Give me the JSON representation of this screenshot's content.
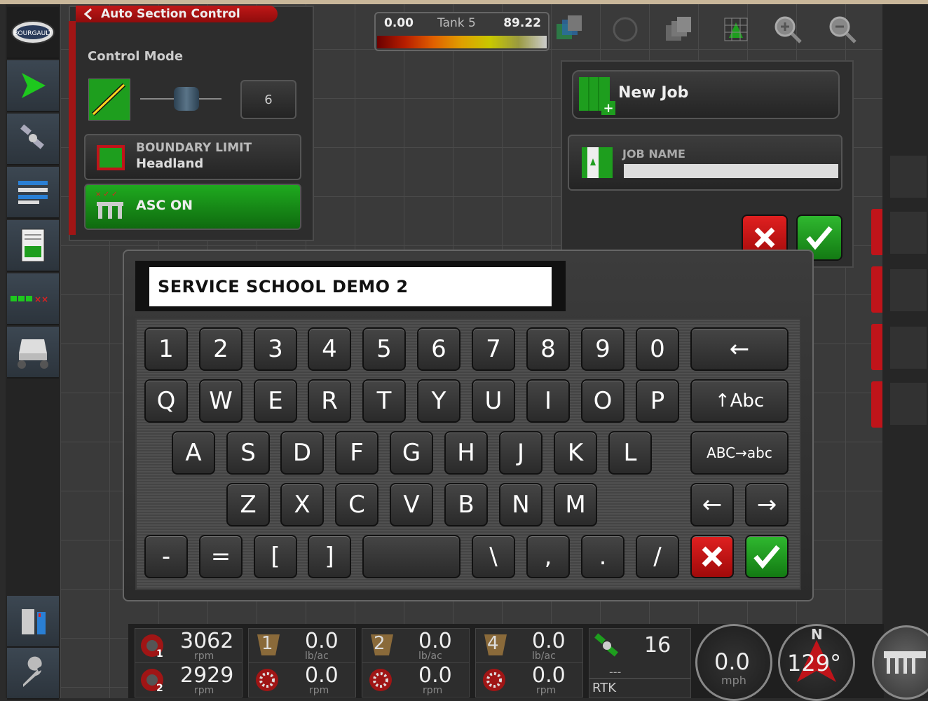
{
  "asc": {
    "title": "Auto Section Control",
    "control_mode_label": "Control Mode",
    "section_value": "6",
    "boundary_label": "BOUNDARY LIMIT",
    "boundary_value": "Headland",
    "asc_label": "ASC ON"
  },
  "tank": {
    "left_value": "0.00",
    "name": "Tank 5",
    "right_value": "89.22"
  },
  "job": {
    "new_job_label": "New Job",
    "job_name_label": "JOB NAME"
  },
  "keyboard": {
    "entry_text": "SERVICE SCHOOL DEMO 2",
    "row1": [
      "1",
      "2",
      "3",
      "4",
      "5",
      "6",
      "7",
      "8",
      "9",
      "0"
    ],
    "row2": [
      "Q",
      "W",
      "E",
      "R",
      "T",
      "Y",
      "U",
      "I",
      "O",
      "P"
    ],
    "row3": [
      "A",
      "S",
      "D",
      "F",
      "G",
      "H",
      "J",
      "K",
      "L"
    ],
    "row4": [
      "Z",
      "X",
      "C",
      "V",
      "B",
      "N",
      "M"
    ],
    "row5": [
      "-",
      "=",
      "[",
      "]",
      "\\",
      ",",
      ".",
      "/"
    ],
    "backspace": "←",
    "shift": "↑Abc",
    "caps": "ABC→abc",
    "left_arrow": "←",
    "right_arrow": "→"
  },
  "status": {
    "fan1_value": "3062",
    "fan1_unit": "rpm",
    "fan2_value": "2929",
    "fan2_unit": "rpm",
    "bin1_num": "1",
    "bin1_rate": "0.0",
    "bin1_rate_unit": "lb/ac",
    "bin1_rpm": "0.0",
    "bin1_rpm_unit": "rpm",
    "bin2_num": "2",
    "bin2_rate": "0.0",
    "bin2_rate_unit": "lb/ac",
    "bin2_rpm": "0.0",
    "bin2_rpm_unit": "rpm",
    "bin4_num": "4",
    "bin4_rate": "0.0",
    "bin4_rate_unit": "lb/ac",
    "bin4_rpm": "0.0",
    "bin4_rpm_unit": "rpm",
    "satellites": "16",
    "gps_dash": "---",
    "gps_mode": "RTK",
    "speed_value": "0.0",
    "speed_unit": "mph",
    "heading_value": "129°",
    "compass_n": "N"
  },
  "colors": {
    "red": "#c0141a",
    "green": "#1e8f1e",
    "panel": "#2d2d2d"
  },
  "icons": [
    "logo-icon",
    "guidance-arrow-icon",
    "satellite-icon",
    "layers-icon",
    "report-icon",
    "sections-icon",
    "cart-icon",
    "bin-icon",
    "wrench-icon",
    "zoom-in-icon",
    "zoom-out-icon",
    "grid-view-icon",
    "layers-stack-icon"
  ]
}
